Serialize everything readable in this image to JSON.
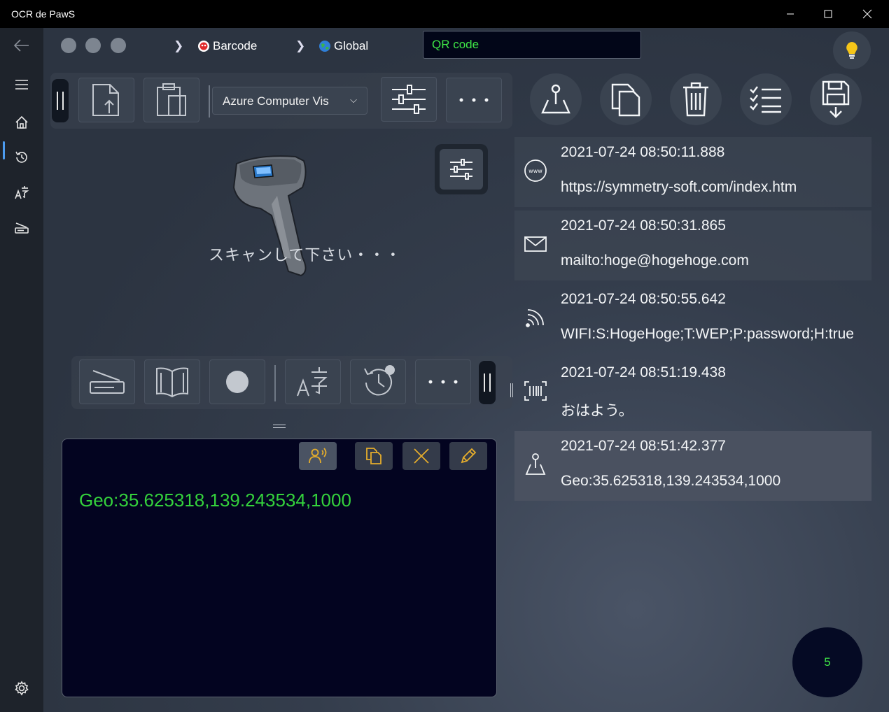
{
  "window": {
    "title": "OCR de PawS"
  },
  "nav": {
    "items": [
      "back",
      "menu",
      "home",
      "history",
      "translate",
      "scanner",
      "settings"
    ]
  },
  "breadcrumb": {
    "item1": "Barcode",
    "item2": "Global"
  },
  "search": {
    "value": "QR code"
  },
  "toolbar": {
    "engine_label": "Azure Computer Vis"
  },
  "scanner": {
    "prompt": "スキャンして下さい・・・"
  },
  "output": {
    "text": "Geo:35.625318,139.243534,1000"
  },
  "history": {
    "items": [
      {
        "icon": "www-icon",
        "time": "2021-07-24 08:50:11.888",
        "value": "https://symmetry-soft.com/index.htm"
      },
      {
        "icon": "mail-icon",
        "time": "2021-07-24 08:50:31.865",
        "value": "mailto:hoge@hogehoge.com"
      },
      {
        "icon": "wifi-icon",
        "time": "2021-07-24 08:50:55.642",
        "value": "WIFI:S:HogeHoge;T:WEP;P:password;H:true"
      },
      {
        "icon": "barcode-scan-icon",
        "time": "2021-07-24 08:51:19.438",
        "value": "おはよう。"
      },
      {
        "icon": "map-pin-icon",
        "time": "2021-07-24 08:51:42.377",
        "value": "Geo:35.625318,139.243534,1000"
      }
    ]
  },
  "counter": {
    "value": "5"
  },
  "colors": {
    "accent_green": "#3ee646",
    "icon_orange": "#e5ad2c",
    "nav_accent": "#4c9bf0"
  }
}
